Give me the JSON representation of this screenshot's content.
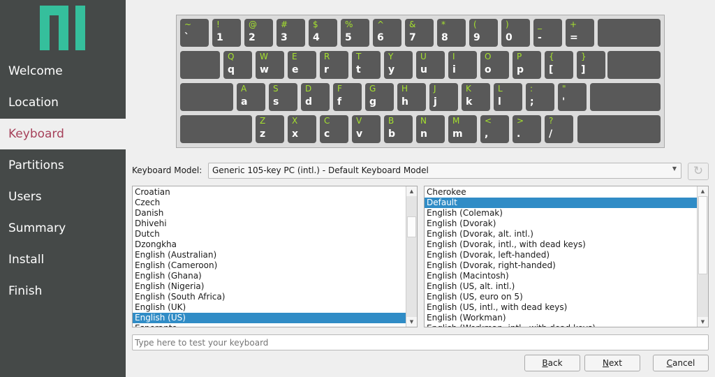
{
  "colors": {
    "sidebar": "#454948",
    "accent": "#a6415a",
    "logo": "#35bf9c",
    "selection": "#308cc6",
    "shift_label": "#a6e22e"
  },
  "sidebar": {
    "items": [
      {
        "label": "Welcome"
      },
      {
        "label": "Location"
      },
      {
        "label": "Keyboard",
        "active": true
      },
      {
        "label": "Partitions"
      },
      {
        "label": "Users"
      },
      {
        "label": "Summary"
      },
      {
        "label": "Install"
      },
      {
        "label": "Finish"
      }
    ]
  },
  "keyboard": {
    "rows": [
      [
        [
          "~",
          "`"
        ],
        [
          "!",
          "1"
        ],
        [
          "@",
          "2"
        ],
        [
          "#",
          "3"
        ],
        [
          "$",
          "4"
        ],
        [
          "%",
          "5"
        ],
        [
          "^",
          "6"
        ],
        [
          "&",
          "7"
        ],
        [
          "*",
          "8"
        ],
        [
          "(",
          "9"
        ],
        [
          ")",
          "0"
        ],
        [
          "_",
          "-"
        ],
        [
          "+",
          "="
        ]
      ],
      [
        [
          "Q",
          "q"
        ],
        [
          "W",
          "w"
        ],
        [
          "E",
          "e"
        ],
        [
          "R",
          "r"
        ],
        [
          "T",
          "t"
        ],
        [
          "Y",
          "y"
        ],
        [
          "U",
          "u"
        ],
        [
          "I",
          "i"
        ],
        [
          "O",
          "o"
        ],
        [
          "P",
          "p"
        ],
        [
          "{",
          "["
        ],
        [
          "}",
          "]"
        ],
        [
          "|",
          "\\"
        ]
      ],
      [
        [
          "A",
          "a"
        ],
        [
          "S",
          "s"
        ],
        [
          "D",
          "d"
        ],
        [
          "F",
          "f"
        ],
        [
          "G",
          "g"
        ],
        [
          "H",
          "h"
        ],
        [
          "J",
          "j"
        ],
        [
          "K",
          "k"
        ],
        [
          "L",
          "l"
        ],
        [
          ":",
          ";"
        ],
        [
          "\"",
          "'"
        ]
      ],
      [
        [
          "Z",
          "z"
        ],
        [
          "X",
          "x"
        ],
        [
          "C",
          "c"
        ],
        [
          "V",
          "v"
        ],
        [
          "B",
          "b"
        ],
        [
          "N",
          "n"
        ],
        [
          "M",
          "m"
        ],
        [
          "<",
          ","
        ],
        [
          ">",
          "."
        ],
        [
          "?",
          "/"
        ]
      ]
    ]
  },
  "model": {
    "label": "Keyboard Model:",
    "value": "Generic 105-key PC (intl.)  -  Default Keyboard Model"
  },
  "layouts": [
    "Croatian",
    "Czech",
    "Danish",
    "Dhivehi",
    "Dutch",
    "Dzongkha",
    "English (Australian)",
    "English (Cameroon)",
    "English (Ghana)",
    "English (Nigeria)",
    "English (South Africa)",
    "English (UK)",
    "English (US)",
    "Esperanto"
  ],
  "layouts_selected": "English (US)",
  "variants": [
    "Cherokee",
    "Default",
    "English (Colemak)",
    "English (Dvorak)",
    "English (Dvorak, alt. intl.)",
    "English (Dvorak, intl., with dead keys)",
    "English (Dvorak, left-handed)",
    "English (Dvorak, right-handed)",
    "English (Macintosh)",
    "English (US, alt. intl.)",
    "English (US, euro on 5)",
    "English (US, intl., with dead keys)",
    "English (Workman)",
    "English (Workman, intl., with dead keys)"
  ],
  "variants_selected": "Default",
  "test": {
    "placeholder": "Type here to test your keyboard"
  },
  "buttons": {
    "back": "Back",
    "next": "Next",
    "cancel": "Cancel"
  }
}
